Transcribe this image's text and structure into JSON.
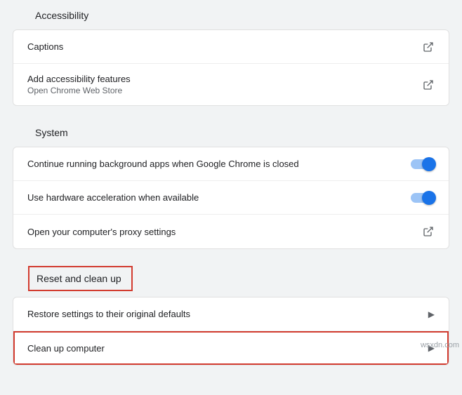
{
  "sections": {
    "accessibility": {
      "title": "Accessibility",
      "captions": "Captions",
      "add_features": "Add accessibility features",
      "add_features_sub": "Open Chrome Web Store"
    },
    "system": {
      "title": "System",
      "bg_apps": "Continue running background apps when Google Chrome is closed",
      "hw_accel": "Use hardware acceleration when available",
      "proxy": "Open your computer's proxy settings"
    },
    "reset": {
      "title": "Reset and clean up",
      "restore": "Restore settings to their original defaults",
      "cleanup": "Clean up computer"
    }
  },
  "watermark": "wsxdn.com"
}
